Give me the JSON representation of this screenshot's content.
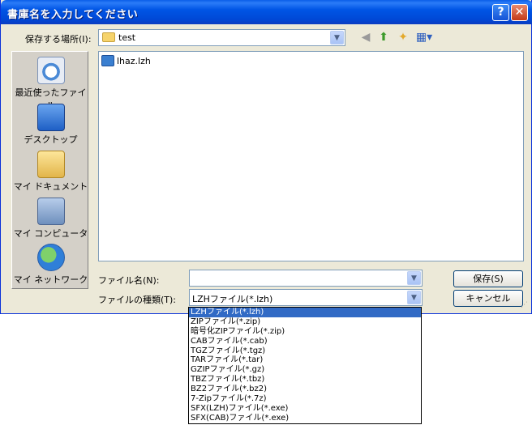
{
  "window": {
    "title": "書庫名を入力してください"
  },
  "save_in": {
    "label": "保存する場所(I):",
    "value": "test"
  },
  "places": [
    {
      "label": "最近使ったファイル",
      "icon": "recent-documents-icon"
    },
    {
      "label": "デスクトップ",
      "icon": "desktop-icon"
    },
    {
      "label": "マイ ドキュメント",
      "icon": "my-documents-icon"
    },
    {
      "label": "マイ コンピュータ",
      "icon": "my-computer-icon"
    },
    {
      "label": "マイ ネットワーク",
      "icon": "my-network-icon"
    }
  ],
  "files": [
    {
      "name": "lhaz.lzh",
      "icon": "archive-file-icon"
    }
  ],
  "filename": {
    "label": "ファイル名(N):",
    "value": ""
  },
  "filetype": {
    "label": "ファイルの種類(T):",
    "value": "LZHファイル(*.lzh)",
    "options": [
      "LZHファイル(*.lzh)",
      "ZIPファイル(*.zip)",
      "暗号化ZIPファイル(*.zip)",
      "CABファイル(*.cab)",
      "TGZファイル(*.tgz)",
      "TARファイル(*.tar)",
      "GZIPファイル(*.gz)",
      "TBZファイル(*.tbz)",
      "BZ2ファイル(*.bz2)",
      "7-Zipファイル(*.7z)",
      "SFX(LZH)ファイル(*.exe)",
      "SFX(CAB)ファイル(*.exe)"
    ],
    "selected_index": 0
  },
  "buttons": {
    "save": "保存(S)",
    "cancel": "キャンセル"
  },
  "titlebar_buttons": {
    "help": "?",
    "close": "✕"
  }
}
